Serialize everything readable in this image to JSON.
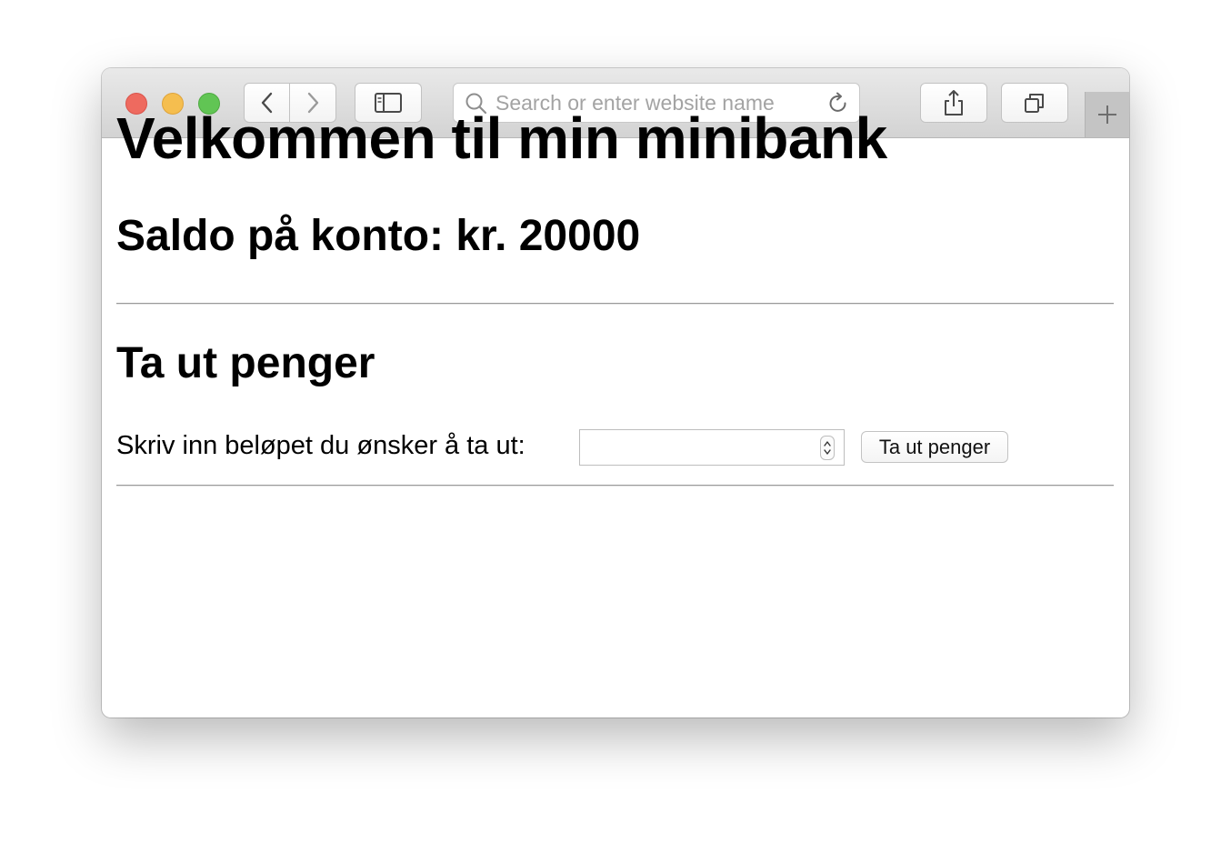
{
  "browser": {
    "address_bar": {
      "placeholder": "Search or enter website name",
      "value": ""
    },
    "icons": [
      "back-icon",
      "forward-icon",
      "sidebar-icon",
      "search-icon",
      "reload-icon",
      "share-icon",
      "tabs-icon",
      "plus-icon"
    ],
    "traffic_light_colors": [
      "#ee6a5f",
      "#f5be4f",
      "#61c554"
    ]
  },
  "page": {
    "title": "Velkommen til min minibank",
    "balance_heading": "Saldo på konto: kr. 20000",
    "withdraw_heading": "Ta ut penger",
    "amount_label": "Skriv inn beløpet du ønsker å ta ut:",
    "amount_value": "",
    "submit_label": "Ta ut penger"
  }
}
